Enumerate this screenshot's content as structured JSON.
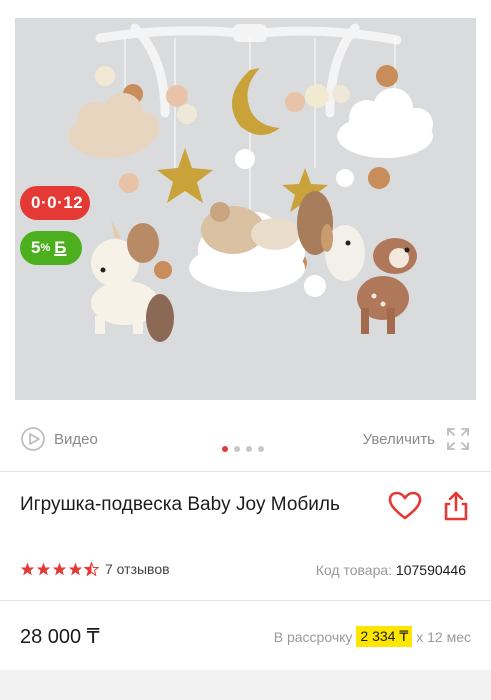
{
  "badges": {
    "installment": "0·0·12",
    "bonus_percent": "5",
    "bonus_pct_sign": "%",
    "bonus_currency": "Б"
  },
  "media": {
    "video_label": "Видео",
    "zoom_label": "Увеличить",
    "dots_count": 4,
    "active_dot": 0
  },
  "product": {
    "title": "Игрушка-подвеска Baby Joy Мобиль",
    "rating_stars": 4.5,
    "reviews": "7 отзывов",
    "code_label": "Код товара:",
    "code_value": "107590446",
    "price": "28 000 ₸",
    "installment_prefix": "В рассрочку",
    "installment_amount": "2 334 ₸",
    "installment_suffix": "х 12 мес"
  },
  "colors": {
    "accent_red": "#e53935",
    "bonus_green": "#4caf1e",
    "installment_highlight": "#ffe600",
    "star": "#e53935"
  }
}
